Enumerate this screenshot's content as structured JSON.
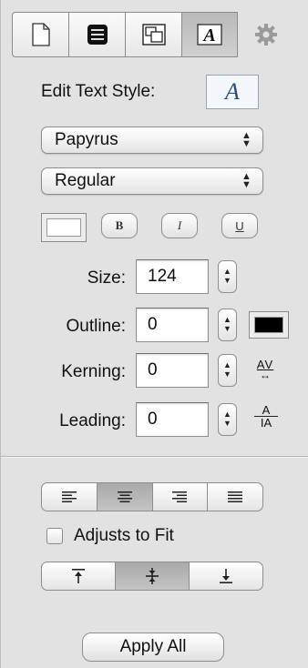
{
  "toolbar": {
    "tabs": [
      {
        "icon": "document-icon"
      },
      {
        "icon": "layout-icon"
      },
      {
        "icon": "image-icon"
      },
      {
        "icon": "text-icon",
        "active": true
      },
      {
        "icon": "gear-icon"
      }
    ]
  },
  "text_style": {
    "label": "Edit Text Style:",
    "preview_glyph": "A"
  },
  "font_family": {
    "value": "Papyrus"
  },
  "font_style": {
    "value": "Regular"
  },
  "style_buttons": {
    "bold": "B",
    "italic": "I",
    "underline": "U"
  },
  "size": {
    "label": "Size:",
    "value": "124"
  },
  "outline": {
    "label": "Outline:",
    "value": "0",
    "color": "#000000"
  },
  "kerning": {
    "label": "Kerning:",
    "value": "0",
    "icon_text": "AV"
  },
  "leading": {
    "label": "Leading:",
    "value": "0",
    "icon_top": "A",
    "icon_bottom": "IA"
  },
  "alignment": {
    "options": [
      "left",
      "center",
      "right",
      "justify"
    ],
    "selected": "center"
  },
  "adjusts_to_fit": {
    "label": "Adjusts to Fit",
    "checked": false
  },
  "vertical_alignment": {
    "options": [
      "top",
      "middle",
      "bottom"
    ],
    "selected": "middle"
  },
  "apply_all": {
    "label": "Apply All"
  }
}
